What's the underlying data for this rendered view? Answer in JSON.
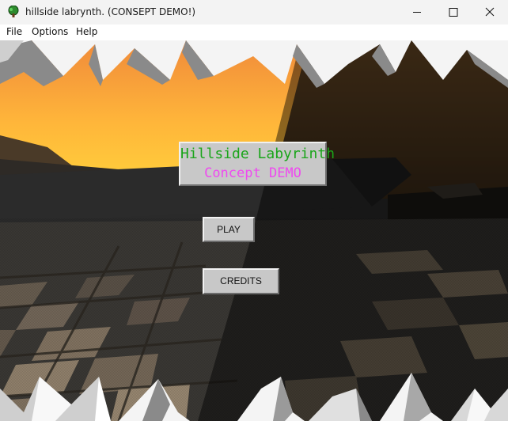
{
  "window": {
    "title": "hillside labrynth. (CONSEPT DEMO!)",
    "app_icon": "tree-icon",
    "controls": [
      "minimize-icon",
      "maximize-icon",
      "close-icon"
    ]
  },
  "menu": {
    "items": [
      {
        "label": "File"
      },
      {
        "label": "Options"
      },
      {
        "label": "Help"
      }
    ]
  },
  "game": {
    "title_line1": "Hillside Labyrinth",
    "title_line2": "Concept DEMO",
    "title_colors": {
      "line1": "#1aa51a",
      "line2": "#ef4af0"
    },
    "buttons": {
      "play": "PLAY",
      "credits": "CREDITS"
    },
    "sky_colors": {
      "top": "#f08a3a",
      "bottom": "#ffd23c"
    }
  }
}
